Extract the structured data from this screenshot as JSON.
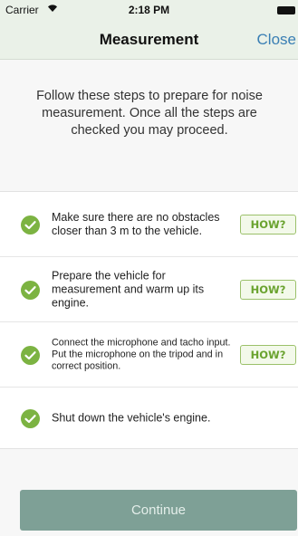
{
  "status_bar": {
    "carrier": "Carrier",
    "time": "2:18 PM",
    "icons": [
      "wifi-icon",
      "battery-icon"
    ]
  },
  "nav": {
    "title": "Measurement",
    "close_label": "Close"
  },
  "intro": {
    "text": "Follow these steps to prepare for noise measurement. Once all the steps are checked you may proceed."
  },
  "steps": [
    {
      "text": "Make sure there are no obstacles closer than 3 m to the vehicle.",
      "checked": true,
      "how_label": "HOW?"
    },
    {
      "text": "Prepare the vehicle for measurement and warm up its engine.",
      "checked": true,
      "how_label": "HOW?"
    },
    {
      "text": "Connect the microphone and tacho input. Put the microphone on the tripod and in correct position.",
      "checked": true,
      "how_label": "HOW?"
    },
    {
      "text": "Shut down the vehicle's engine.",
      "checked": true
    }
  ],
  "continue_label": "Continue",
  "colors": {
    "check_green": "#7cb342",
    "how_green": "#6aa32f",
    "link_blue": "#3a7fb4",
    "continue_bg": "#7ea096",
    "header_bg": "#eaf1e8"
  }
}
